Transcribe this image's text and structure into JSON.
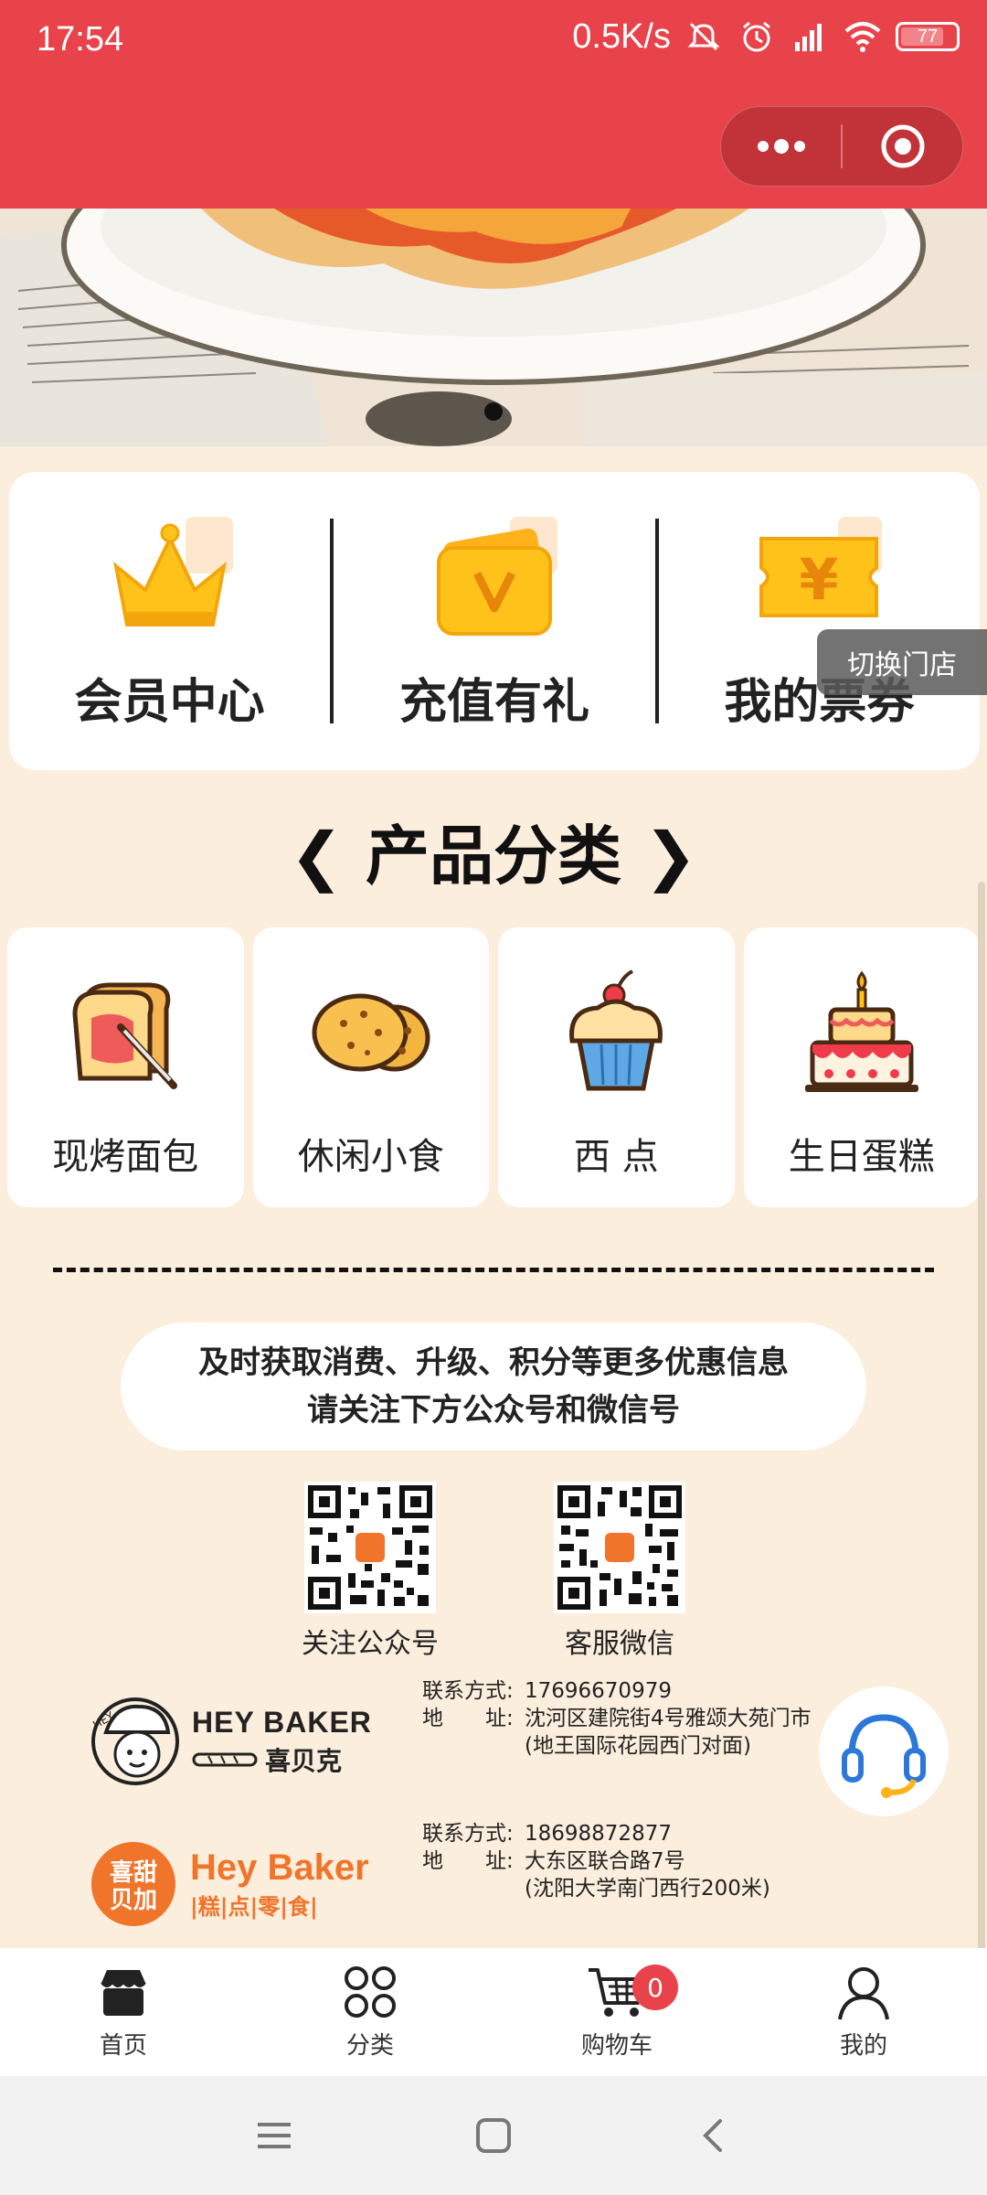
{
  "status_bar": {
    "time": "17:54",
    "net_speed": "0.5K/s",
    "battery": "77",
    "icons": [
      "mute-icon",
      "alarm-icon",
      "signal-icon",
      "wifi-icon",
      "battery-icon"
    ]
  },
  "header": {
    "capsule_icons": [
      "more-dots-icon",
      "close-target-icon"
    ],
    "accent": "#e8434a"
  },
  "quick_menu": [
    {
      "label": "会员中心",
      "icon": "crown-icon"
    },
    {
      "label": "充值有礼",
      "icon": "wallet-icon"
    },
    {
      "label": "我的票券",
      "icon": "ticket-icon"
    }
  ],
  "switch_store": "切换门店",
  "section_title": "❮ 产品分类 ❯",
  "categories": [
    {
      "label": "现烤面包",
      "icon": "toast-icon"
    },
    {
      "label": "休闲小食",
      "icon": "cookie-icon"
    },
    {
      "label": "西 点",
      "icon": "cupcake-icon"
    },
    {
      "label": "生日蛋糕",
      "icon": "cake-icon"
    }
  ],
  "notice": {
    "line1": "及时获取消费、升级、积分等更多优惠信息",
    "line2": "请关注下方公众号和微信号"
  },
  "qr_codes": [
    {
      "label": "关注公众号"
    },
    {
      "label": "客服微信"
    }
  ],
  "stores": [
    {
      "brand": "HEY BAKER",
      "brand_cn": "喜贝克",
      "contact_label": "联系方式:",
      "phone": "17696670979",
      "addr_label": "地　　址:",
      "address": "沈河区建院街4号雅颂大苑门市",
      "note": "(地王国际花园西门对面)"
    },
    {
      "brand": "Hey Baker",
      "brand_cn": "喜甜贝加",
      "tagline": "|糕|点|零|食|",
      "contact_label": "联系方式:",
      "phone": "18698872877",
      "addr_label": "地　　址:",
      "address": "大东区联合路7号",
      "note": "(沈阳大学南门西行200米)"
    }
  ],
  "tabbar": [
    {
      "label": "首页",
      "icon": "store-icon"
    },
    {
      "label": "分类",
      "icon": "grid-icon"
    },
    {
      "label": "购物车",
      "icon": "cart-icon",
      "badge": "0"
    },
    {
      "label": "我的",
      "icon": "user-icon"
    }
  ]
}
